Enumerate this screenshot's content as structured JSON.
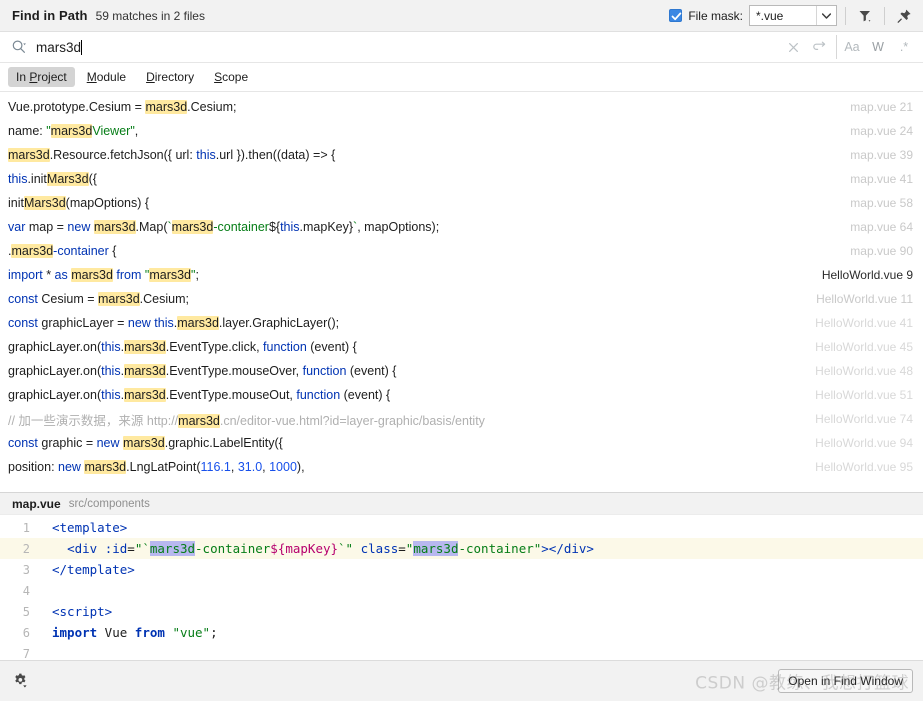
{
  "window": {
    "title": "Find in Path",
    "summary": "59 matches in 2 files"
  },
  "titlebar": {
    "file_mask_label": "File mask:",
    "file_mask_value": "*.vue",
    "file_mask_checked": true,
    "filter_icon": "filter-icon",
    "pin_icon": "pin-icon"
  },
  "search": {
    "value": "mars3d",
    "placeholder": "",
    "search_icon": "search-icon",
    "clear_icon": "clear-icon",
    "history_icon": "reset-icon",
    "match_case_label": "Aa",
    "words_label": "W",
    "regex_label": ".*"
  },
  "tabs": [
    {
      "label": "In Project",
      "mnemonic": "P",
      "active": true
    },
    {
      "label": "Module",
      "mnemonic": "M",
      "active": false
    },
    {
      "label": "Directory",
      "mnemonic": "D",
      "active": false
    },
    {
      "label": "Scope",
      "mnemonic": "S",
      "active": false
    }
  ],
  "results": [
    {
      "text": "Vue.prototype.Cesium = mars3d.Cesium;",
      "file": "map.vue",
      "line": "21",
      "tone": "mid"
    },
    {
      "text": "name: \"mars3dViewer\",",
      "file": "map.vue",
      "line": "24",
      "tone": "mid"
    },
    {
      "text": "mars3d.Resource.fetchJson({ url: this.url }).then((data) => {",
      "file": "map.vue",
      "line": "39",
      "tone": "mid"
    },
    {
      "text": "this.initMars3d({",
      "file": "map.vue",
      "line": "41",
      "tone": "mid"
    },
    {
      "text": "initMars3d(mapOptions) {",
      "file": "map.vue",
      "line": "58",
      "tone": "mid"
    },
    {
      "text": "var map = new mars3d.Map(`mars3d-container${this.mapKey}`, mapOptions);",
      "file": "map.vue",
      "line": "64",
      "tone": "mid"
    },
    {
      "text": ".mars3d-container {",
      "file": "map.vue",
      "line": "90",
      "tone": "mid"
    },
    {
      "text": "import * as mars3d from \"mars3d\";",
      "file": "HelloWorld.vue",
      "line": "9",
      "tone": "dark"
    },
    {
      "text": "const Cesium = mars3d.Cesium;",
      "file": "HelloWorld.vue",
      "line": "11",
      "tone": "mid"
    },
    {
      "text": "const graphicLayer = new this.mars3d.layer.GraphicLayer();",
      "file": "HelloWorld.vue",
      "line": "41",
      "tone": "soft"
    },
    {
      "text": "graphicLayer.on(this.mars3d.EventType.click, function (event) {",
      "file": "HelloWorld.vue",
      "line": "45",
      "tone": "soft"
    },
    {
      "text": "graphicLayer.on(this.mars3d.EventType.mouseOver, function (event) {",
      "file": "HelloWorld.vue",
      "line": "48",
      "tone": "soft"
    },
    {
      "text": "graphicLayer.on(this.mars3d.EventType.mouseOut, function (event) {",
      "file": "HelloWorld.vue",
      "line": "51",
      "tone": "soft"
    },
    {
      "text": "// 加一些演示数据，来源 http://mars3d.cn/editor-vue.html?id=layer-graphic/basis/entity",
      "file": "HelloWorld.vue",
      "line": "74",
      "tone": "soft"
    },
    {
      "text": "const graphic = new mars3d.graphic.LabelEntity({",
      "file": "HelloWorld.vue",
      "line": "94",
      "tone": "soft"
    },
    {
      "text": "position: new mars3d.LngLatPoint(116.1, 31.0, 1000),",
      "file": "HelloWorld.vue",
      "line": "95",
      "tone": "soft"
    }
  ],
  "preview": {
    "file": "map.vue",
    "path": "src/components",
    "current_line": 2,
    "lines": [
      {
        "no": "1",
        "text": "<template>"
      },
      {
        "no": "2",
        "text": "  <div :id=\"`mars3d-container${mapKey}`\" class=\"mars3d-container\"></div>"
      },
      {
        "no": "3",
        "text": "</template>"
      },
      {
        "no": "4",
        "text": ""
      },
      {
        "no": "5",
        "text": "<script>"
      },
      {
        "no": "6",
        "text": "import Vue from \"vue\";"
      },
      {
        "no": "7",
        "text": ""
      }
    ]
  },
  "statusbar": {
    "settings_icon": "gear-icon",
    "open_button_label": "Open in Find Window",
    "watermark": "CSDN @教练、我想打篮球"
  },
  "colors": {
    "highlight": "#ffe9a0",
    "selection": "#b8b8ef",
    "accent": "#3b87e3",
    "keyword": "#0033b3",
    "string": "#067d17",
    "number": "#1750eb"
  }
}
